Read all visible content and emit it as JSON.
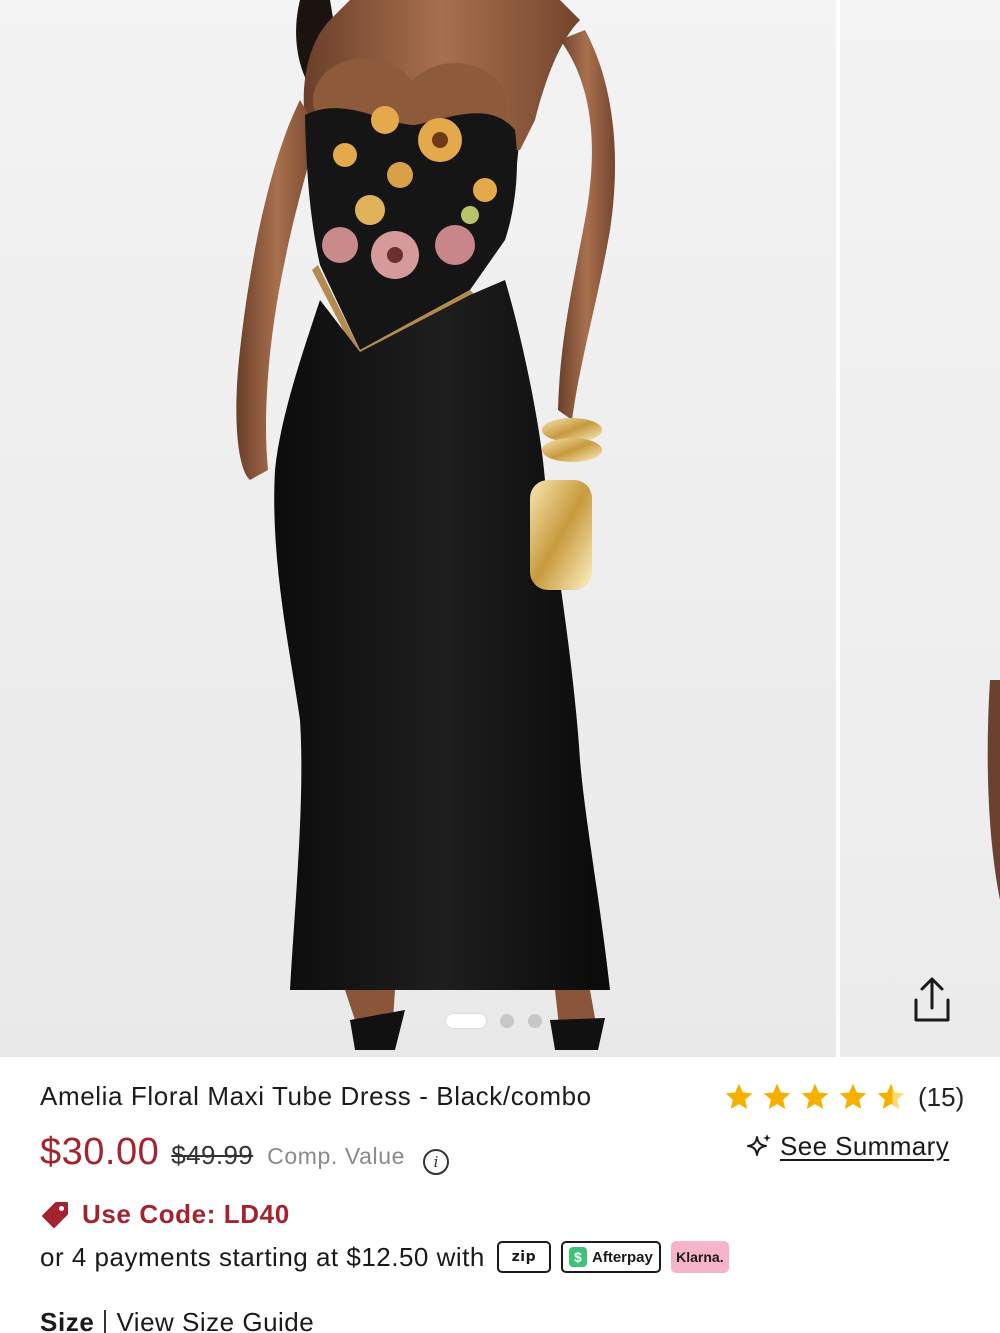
{
  "gallery": {
    "slide_count": 3,
    "active_index": 0,
    "share_icon": "share-icon"
  },
  "product": {
    "title": "Amelia Floral Maxi Tube Dress - Black/combo",
    "price": "$30.00",
    "original_price": "$49.99",
    "comp_value_label": "Comp. Value",
    "info_icon": "info-icon"
  },
  "rating": {
    "stars": 4.5,
    "max_stars": 5,
    "count": "(15)",
    "star_color": "#f5b000"
  },
  "summary": {
    "icon": "sparkle-icon",
    "label": "See Summary"
  },
  "promo": {
    "icon": "tag-icon",
    "text": "Use Code: LD40",
    "color": "#a3232e"
  },
  "payments": {
    "text": "or 4 payments starting at $12.50 with",
    "providers": {
      "zip": "zip",
      "afterpay": "Afterpay",
      "klarna": "Klarna."
    }
  },
  "size": {
    "label": "Size",
    "guide_link": "View Size Guide"
  }
}
